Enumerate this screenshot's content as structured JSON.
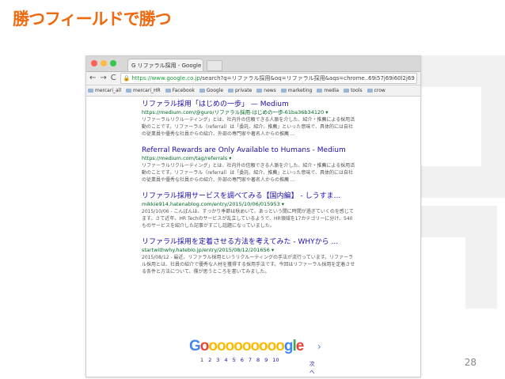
{
  "slide": {
    "title": "勝つフィールドで勝つ",
    "page_number": "28",
    "accent_color": "#ef6a0e"
  },
  "browser": {
    "tab": {
      "favicon": "G",
      "title": "G リファラル採用 - Google 検索",
      "close": "×"
    },
    "nav": {
      "back": "←",
      "forward": "→",
      "reload": "C"
    },
    "address": {
      "host": "https://www.google.co.jp",
      "rest": "/search?q=リファラル採用&oq=リファラル採用&aqs=chrome..69i57j69i60l2j69"
    },
    "bookmarks": [
      {
        "label": "mercari_all",
        "icon": "folder-icon"
      },
      {
        "label": "mercari_HR",
        "icon": "folder-icon"
      },
      {
        "label": "Facebook",
        "icon": "facebook-icon"
      },
      {
        "label": "Google",
        "icon": "google-icon"
      },
      {
        "label": "private",
        "icon": "folder-icon"
      },
      {
        "label": "news",
        "icon": "folder-icon"
      },
      {
        "label": "marketing",
        "icon": "folder-icon"
      },
      {
        "label": "media",
        "icon": "folder-icon"
      },
      {
        "label": "tools",
        "icon": "folder-icon"
      },
      {
        "label": "crow",
        "icon": "folder-icon"
      }
    ]
  },
  "results": [
    {
      "title": "リファラル採用「はじめの一歩」 — Medium",
      "url": "https://medium.com/@guro/リファラル採用-はじめの一歩-61ba36b34120 ▾",
      "snippet": "リファーラルリクルーティング」とは、社内外の信頼できる人脈を介した、紹介・推薦による採用活動のことです。リファーラル（referral）は「委託、紹介、推薦」といった意味で、具体的には自社の従業員や優秀な社員からの紹介、外部の専門家や著名人からの推薦 ..."
    },
    {
      "title": "Referral Rewards are Only Available to Humans - Medium",
      "url": "https://medium.com/tag/referrals ▾",
      "snippet": "リファーラルリクルーティング」とは、社内外の信頼できる人脈を介した、紹介・推薦による採用活動のことです。リファーラル（referral）は「委託、紹介、推薦」といった意味で、具体的には自社の従業員や優秀な社員からの紹介、外部の専門家や著名人からの推薦 ..."
    },
    {
      "title": "リファラル採用サービスを調べてみる【国内編】 - しうすま...",
      "url": "mikkie914.hatenablog.com/entry/2015/10/06/015953 ▾",
      "snippet": "2015/10/06 - こんばんは、すっかり季節は秋めいて、あっという間に時間が過ぎていくのを感じてます。さて近年、HR Techのサービスが乱立しているようで、HR領域を17カテゴリーに分け、540ものサービスを紹介した記事がすごし話題になっていました。"
    },
    {
      "title": "リファラル採用を定着させる方法を考えてみた - WHYから ...",
      "url": "startwithwhy.hateblo.jp/entry/2015/08/12/201656 ▾",
      "snippet": "2015/08/12 - 最近、リファラル採用というリクルーティングの手法が流行っています。リファーラル採用とは、社員の紹介で優秀な人材を獲得する採用手法です。今回はリファーラル採用を定着させる条件と方法について、僕が思うところを書いてみました。"
    }
  ],
  "pagination": {
    "letters": [
      {
        "ch": "G",
        "color": "#4285f4"
      },
      {
        "ch": "o",
        "color": "#ea4335"
      },
      {
        "ch": "o",
        "color": "#fbbc05"
      },
      {
        "ch": "o",
        "color": "#fbbc05"
      },
      {
        "ch": "o",
        "color": "#fbbc05"
      },
      {
        "ch": "o",
        "color": "#fbbc05"
      },
      {
        "ch": "o",
        "color": "#fbbc05"
      },
      {
        "ch": "o",
        "color": "#fbbc05"
      },
      {
        "ch": "o",
        "color": "#fbbc05"
      },
      {
        "ch": "o",
        "color": "#fbbc05"
      },
      {
        "ch": "o",
        "color": "#fbbc05"
      },
      {
        "ch": "g",
        "color": "#4285f4"
      },
      {
        "ch": "l",
        "color": "#34a853"
      },
      {
        "ch": "e",
        "color": "#ea4335"
      }
    ],
    "pages": [
      "1",
      "2",
      "3",
      "4",
      "5",
      "6",
      "7",
      "8",
      "9",
      "10"
    ],
    "next": "次へ",
    "next_arrow": "›"
  }
}
